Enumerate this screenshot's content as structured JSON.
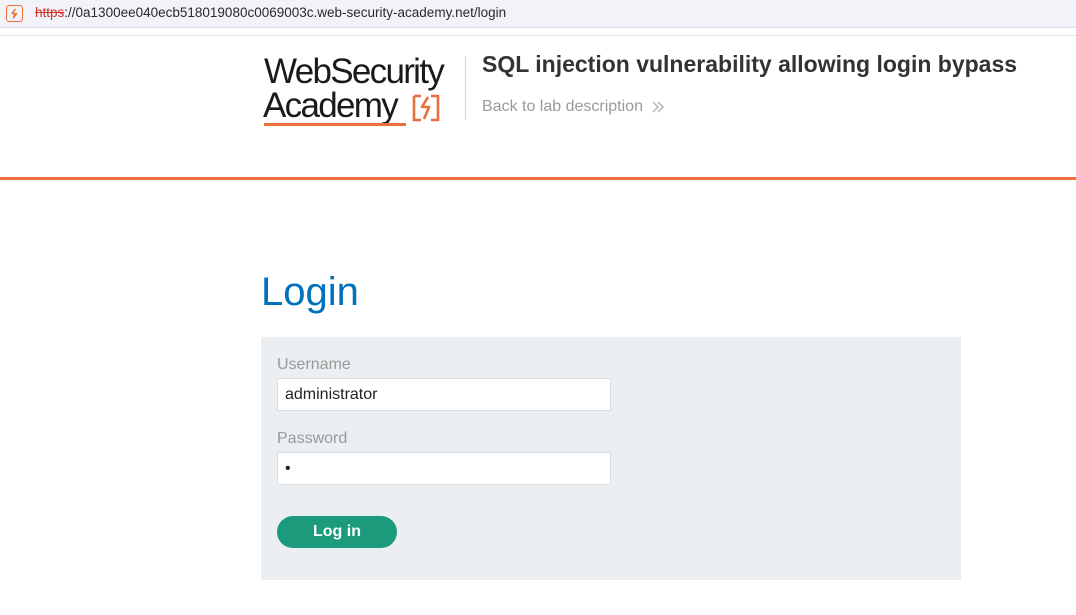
{
  "browser": {
    "url_protocol": "https",
    "url_rest": "://0a1300ee040ecb518019080c0069003c.web-security-academy.net/login",
    "site_icon": "academy-bolt-icon"
  },
  "header": {
    "logo_line1": "WebSecurity",
    "logo_line2": "Academy",
    "lab_title": "SQL injection vulnerability allowing login bypass",
    "back_link": "Back to lab description",
    "back_icon": "double-chevron-right-icon"
  },
  "login": {
    "heading": "Login",
    "username_label": "Username",
    "username_value": "administrator",
    "password_label": "Password",
    "password_value": "•",
    "submit_label": "Log in"
  },
  "colors": {
    "accent_orange": "#e8703a",
    "heading_blue": "#0071bc",
    "button_green": "#1b9b7c",
    "panel_bg": "#ebeff1"
  }
}
